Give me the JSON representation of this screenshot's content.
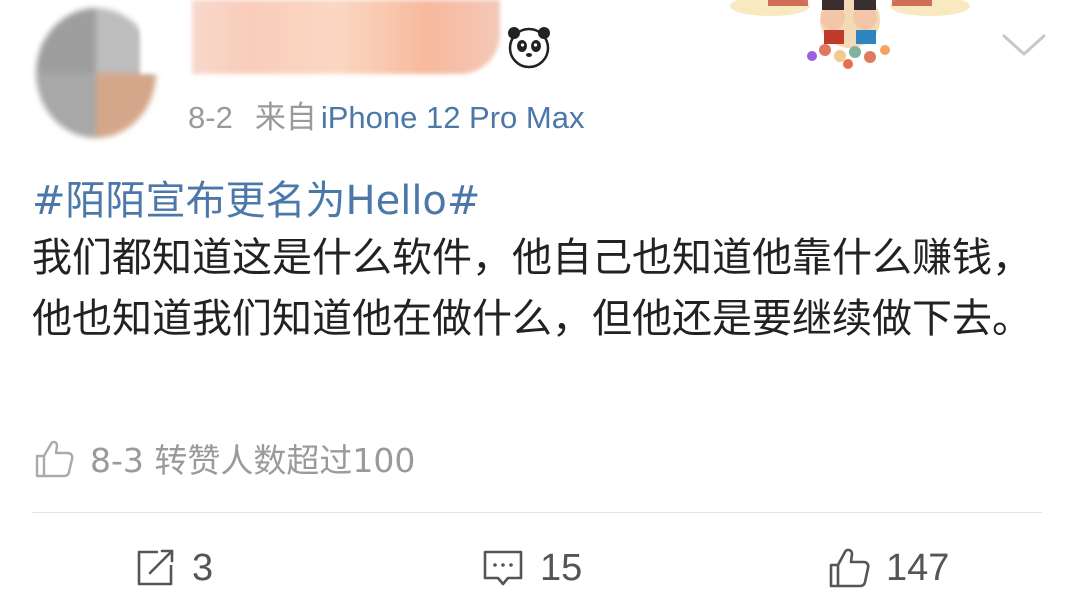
{
  "post": {
    "date": "8-2",
    "source_prefix": "来自",
    "device": "iPhone 12 Pro Max",
    "hashtag": "#陌陌宣布更名为Hello#",
    "text": "我们都知道这是什么软件，他自己也知道他靠什么赚钱，他也知道我们知道他在做什么，但他还是要继续做下去。"
  },
  "like_note": {
    "text": "8-3 转赞人数超过100",
    "icon": "thumbs-up-icon"
  },
  "actions": {
    "repost_count": "3",
    "comment_count": "15",
    "like_count": "147"
  },
  "icons": {
    "badge": "panda-icon",
    "menu": "chevron-down-icon",
    "repost": "repost-icon",
    "comment": "comment-icon",
    "like": "thumbs-up-icon"
  },
  "colors": {
    "link_blue": "#4b78a8",
    "meta_gray": "#9a9a9a",
    "text": "#222222"
  }
}
